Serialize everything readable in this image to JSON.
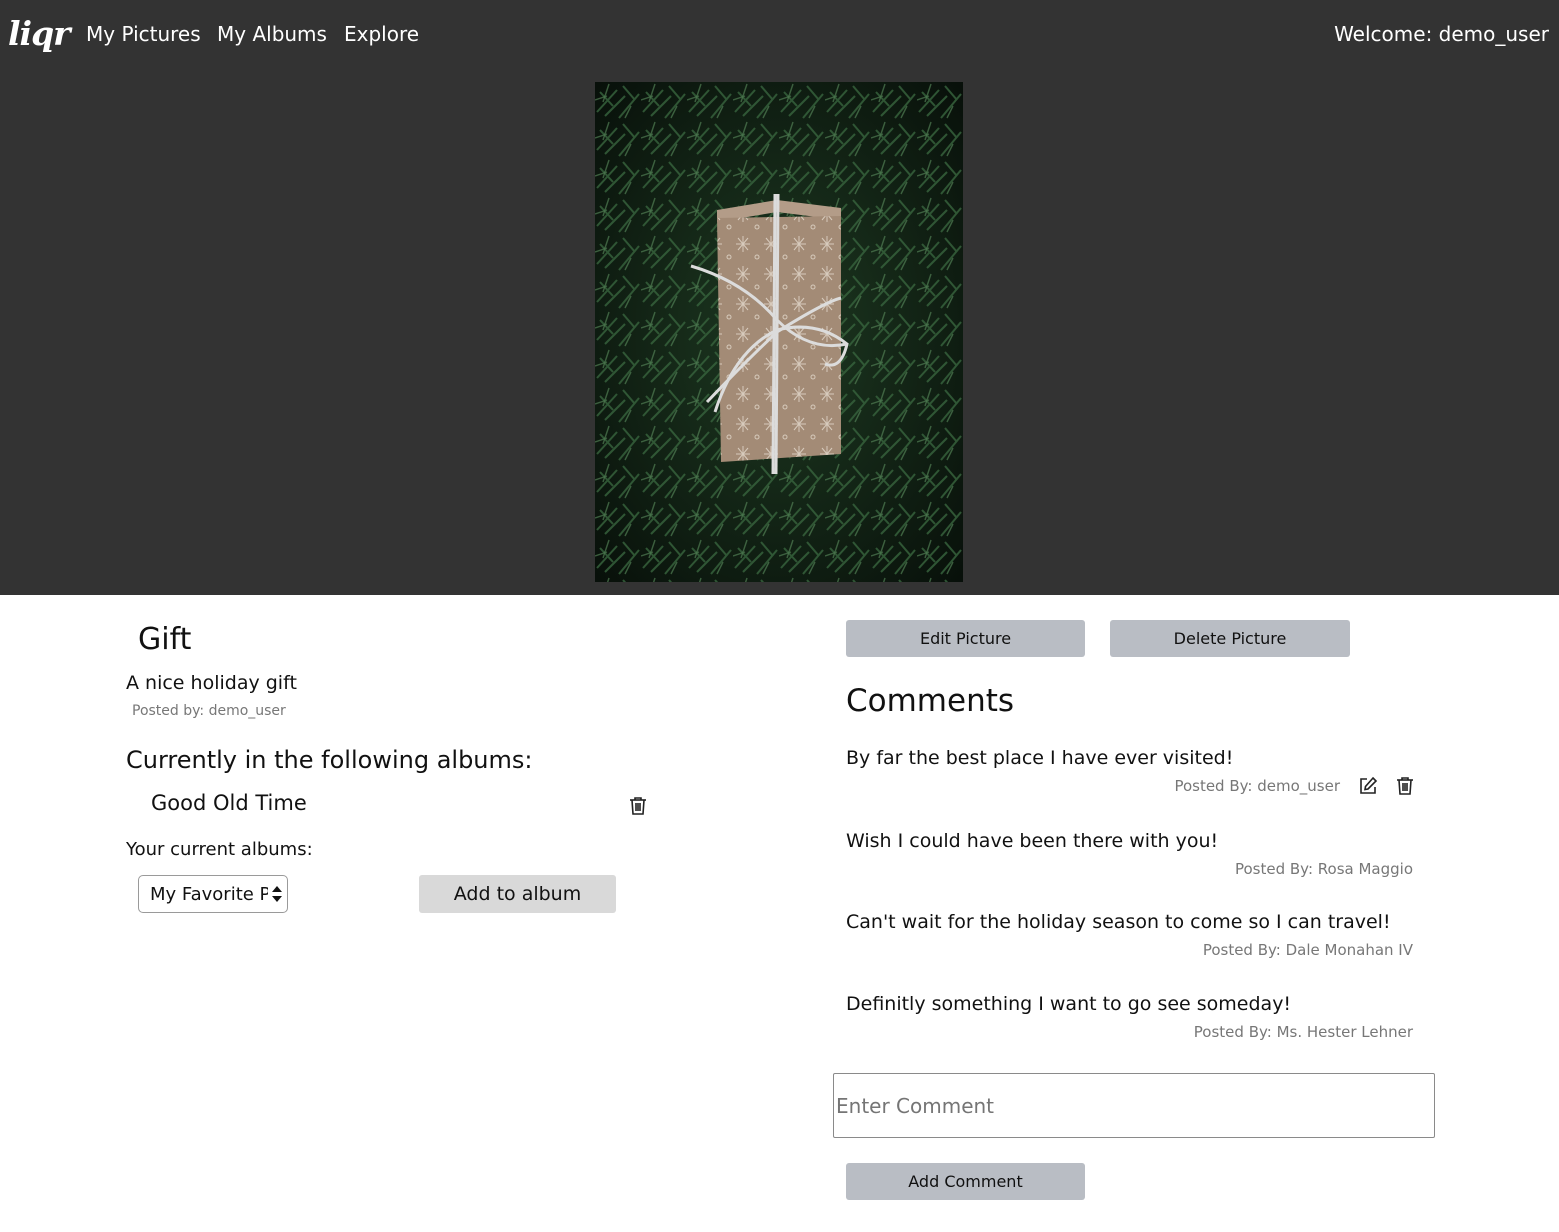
{
  "header": {
    "logo": "liqr",
    "nav": [
      "My Pictures",
      "My Albums",
      "Explore"
    ],
    "welcome": "Welcome: demo_user"
  },
  "picture": {
    "title": "Gift",
    "description": "A nice holiday gift",
    "posted_by": "Posted by: demo_user"
  },
  "albums": {
    "heading": "Currently in the following albums:",
    "items": [
      "Good Old Time"
    ],
    "current_label": "Your current albums:",
    "select_value": "My Favorite Pictures",
    "add_button": "Add to album"
  },
  "actions": {
    "edit": "Edit Picture",
    "delete": "Delete Picture"
  },
  "comments": {
    "heading": "Comments",
    "items": [
      {
        "text": "By far the best place I have ever visited!",
        "author": "Posted By: demo_user"
      },
      {
        "text": "Wish I could have been there with you!",
        "author": "Posted By: Rosa Maggio"
      },
      {
        "text": "Can't wait for the holiday season to come so I can travel!",
        "author": "Posted By: Dale Monahan IV"
      },
      {
        "text": "Definitly something I want to go see someday!",
        "author": "Posted By: Ms. Hester Lehner"
      }
    ],
    "input_placeholder": "Enter Comment",
    "add_button": "Add Comment"
  },
  "colors": {
    "header_bg": "#333333",
    "button_blue": "#b9bdc4",
    "button_grey": "#d9d9d9",
    "meta_text": "#777777"
  }
}
